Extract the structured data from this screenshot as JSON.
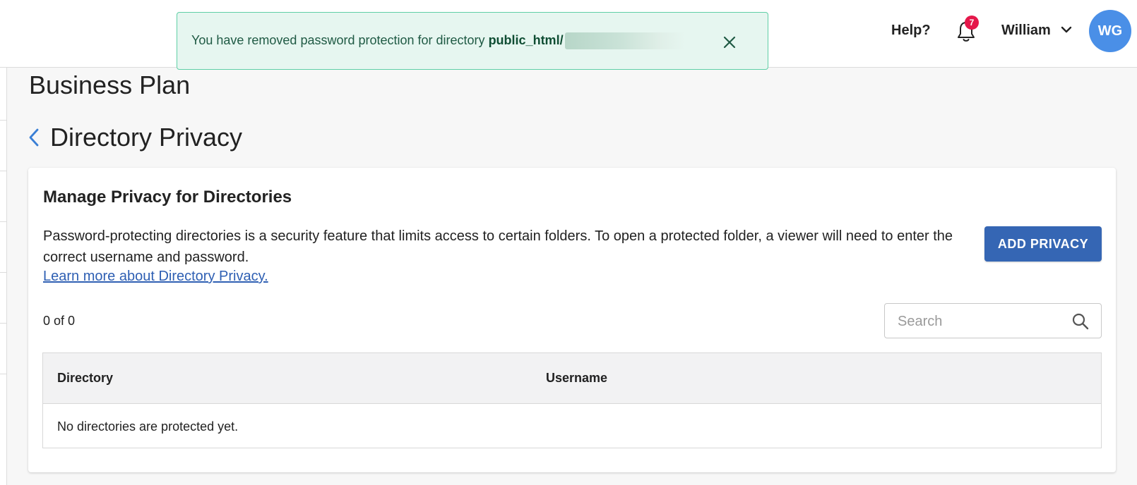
{
  "toast": {
    "message_prefix": "You have removed password protection for directory ",
    "directory": "public_html/"
  },
  "header": {
    "help_label": "Help?",
    "notification_count": "7",
    "user_name": "William",
    "avatar_initials": "WG"
  },
  "page": {
    "plan_title": "Business Plan",
    "title": "Directory Privacy"
  },
  "card": {
    "title": "Manage Privacy for Directories",
    "description": "Password-protecting directories is a security feature that limits access to certain folders. To open a protected folder, a viewer will need to enter the correct username and password.",
    "learn_more": "Learn more about Directory Privacy.",
    "add_button": "ADD PRIVACY",
    "count_text": "0 of 0",
    "search_placeholder": "Search"
  },
  "table": {
    "columns": [
      "Directory",
      "Username"
    ],
    "empty_message": "No directories are protected yet."
  },
  "colors": {
    "accent": "#3566b4",
    "toast_bg": "#e6f6f0",
    "toast_border": "#5fcfa6",
    "badge": "#e5174a",
    "avatar": "#4a8fe7"
  }
}
